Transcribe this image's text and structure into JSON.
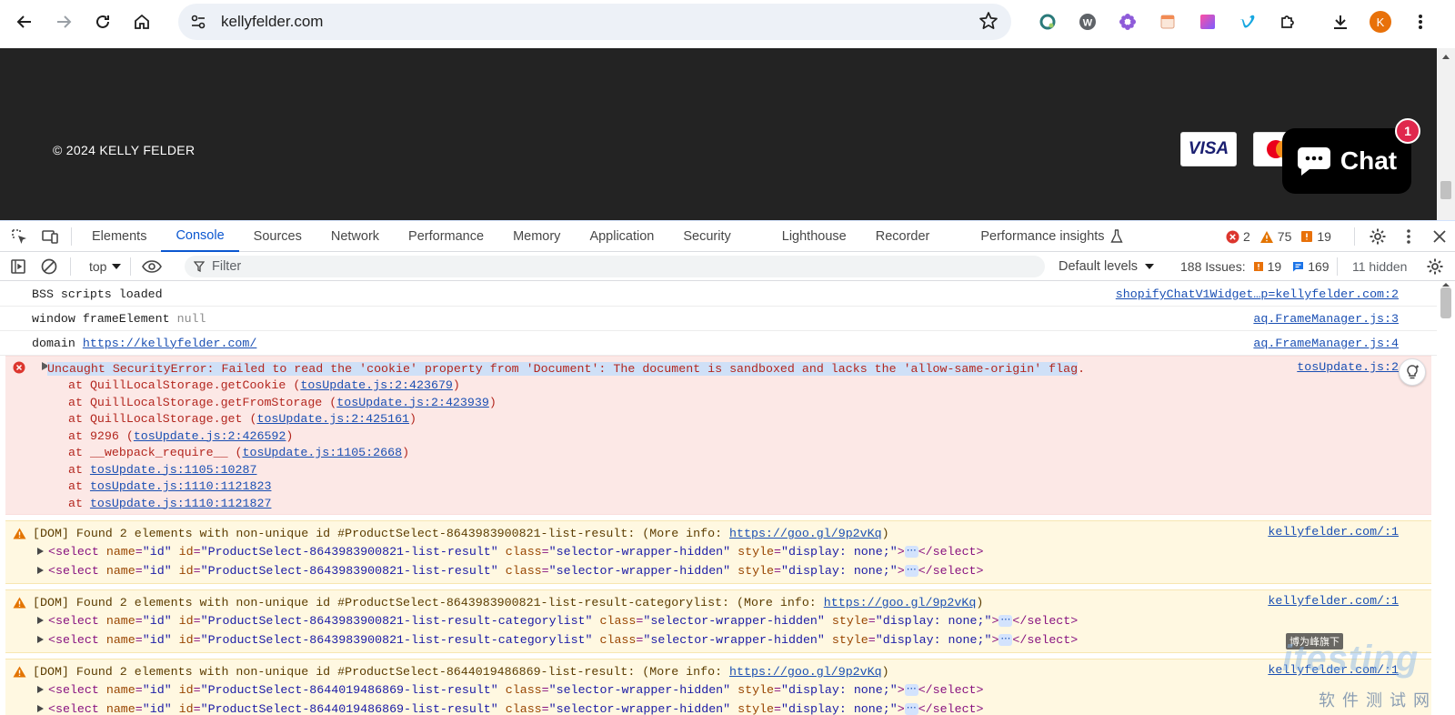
{
  "browser": {
    "url": "kellyfelder.com",
    "avatar_letter": "K"
  },
  "page": {
    "copyright": "© 2024 KELLY FELDER",
    "visa_label": "VISA",
    "chat_label": "Chat",
    "chat_badge": "1"
  },
  "devtools": {
    "tabs": [
      "Elements",
      "Console",
      "Sources",
      "Network",
      "Performance",
      "Memory",
      "Application",
      "Security",
      "Lighthouse",
      "Recorder",
      "Performance insights"
    ],
    "active_tab": "Console",
    "error_count": "2",
    "warning_count": "75",
    "issue_count": "19",
    "context": "top",
    "filter_placeholder": "Filter",
    "levels": "Default levels",
    "issues_label": "188 Issues:",
    "issues_warn": "19",
    "issues_info": "169",
    "hidden": "11 hidden"
  },
  "console": {
    "log1": {
      "text": "BSS scripts loaded",
      "src": "shopifyChatV1Widget…p=kellyfelder.com:2"
    },
    "log2": {
      "text": "window frameElement ",
      "null": "null",
      "src": "aq.FrameManager.js:3"
    },
    "log3": {
      "text": "domain ",
      "link": "https://kellyfelder.com/",
      "src": "aq.FrameManager.js:4"
    },
    "error": {
      "head": "Uncaught SecurityError: Failed to read the 'cookie' property from 'Document': The document is sandboxed and lacks the 'allow-same-origin' flag",
      "dot": ".",
      "src": "tosUpdate.js:2",
      "stack": [
        {
          "pre": "at QuillLocalStorage.getCookie (",
          "link": "tosUpdate.js:2:423679",
          "post": ")"
        },
        {
          "pre": "at QuillLocalStorage.getFromStorage (",
          "link": "tosUpdate.js:2:423939",
          "post": ")"
        },
        {
          "pre": "at QuillLocalStorage.get (",
          "link": "tosUpdate.js:2:425161",
          "post": ")"
        },
        {
          "pre": "at 9296 (",
          "link": "tosUpdate.js:2:426592",
          "post": ")"
        },
        {
          "pre": "at __webpack_require__ (",
          "link": "tosUpdate.js:1105:2668",
          "post": ")"
        },
        {
          "pre": "at ",
          "link": "tosUpdate.js:1105:10287",
          "post": ""
        },
        {
          "pre": "at ",
          "link": "tosUpdate.js:1110:1121823",
          "post": ""
        },
        {
          "pre": "at ",
          "link": "tosUpdate.js:1110:1121827",
          "post": ""
        }
      ]
    },
    "warnings": [
      {
        "head": "[DOM] Found 2 elements with non-unique id #ProductSelect-8643983900821-list-result: (More info: ",
        "link": "https://goo.gl/9p2vKq",
        "tail": ")",
        "src": "kellyfelder.com/:1",
        "id": "ProductSelect-8643983900821-list-result"
      },
      {
        "head": "[DOM] Found 2 elements with non-unique id #ProductSelect-8643983900821-list-result-categorylist: (More info: ",
        "link": "https://goo.gl/9p2vKq",
        "tail": ")",
        "src": "kellyfelder.com/:1",
        "id": "ProductSelect-8643983900821-list-result-categorylist"
      },
      {
        "head": "[DOM] Found 2 elements with non-unique id #ProductSelect-8644019486869-list-result: (More info: ",
        "link": "https://goo.gl/9p2vKq",
        "tail": ")",
        "src": "kellyfelder.com/:1",
        "id": "ProductSelect-8644019486869-list-result"
      }
    ],
    "node": {
      "open": "<select",
      "name_attr": " name",
      "name_val": "\"id\"",
      "id_attr": " id",
      "class_attr": " class",
      "class_val": "\"selector-wrapper-hidden\"",
      "style_attr": " style",
      "style_val": "\"display: none;\"",
      "gt": ">",
      "ellipsis": "⋯",
      "close": "</select>"
    }
  },
  "watermark": {
    "top": "博为峰旗下",
    "main": "itesting",
    "sub": "软件测试网"
  }
}
